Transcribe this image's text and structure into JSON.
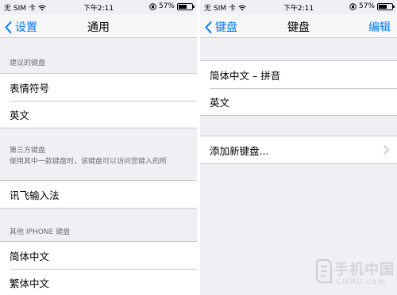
{
  "colors": {
    "accent": "#007aff",
    "background": "#efeff4",
    "separator": "#c8c7cc",
    "section_text": "#6d6d72"
  },
  "left": {
    "status": {
      "carrier": "无 SIM 卡",
      "time": "下午2:11",
      "battery": "57%",
      "battery_level": 0.57
    },
    "nav": {
      "back_label": "设置",
      "title": "通用"
    },
    "sections": {
      "suggested": {
        "header": "建议的键盘",
        "items": [
          "表情符号",
          "英文"
        ]
      },
      "third_party": {
        "header": "第三方键盘",
        "footer": "使用其中一款键盘时，该键盘可以访问您键入的所",
        "items": [
          "讯飞输入法"
        ]
      },
      "other": {
        "header": "其他 IPHONE 键盘",
        "items": [
          "简体中文",
          "繁体中文"
        ]
      }
    }
  },
  "right": {
    "status": {
      "carrier": "无 SIM 卡",
      "time": "下午2:11",
      "battery": "57%",
      "battery_level": 0.57
    },
    "nav": {
      "back_label": "键盘",
      "title": "键盘",
      "edit_label": "编辑"
    },
    "keyboards": [
      "简体中文 – 拼音",
      "英文"
    ],
    "add_keyboard_label": "添加新键盘..."
  },
  "watermark": {
    "main": "手机中国",
    "sub": "CNMO.com"
  },
  "icons": {
    "wifi": "wifi-icon",
    "lock": "lock-rotation-icon",
    "battery": "battery-icon",
    "back": "chevron-left-icon",
    "disclosure": "chevron-right-icon",
    "logo": "cnmo-logo-icon"
  }
}
